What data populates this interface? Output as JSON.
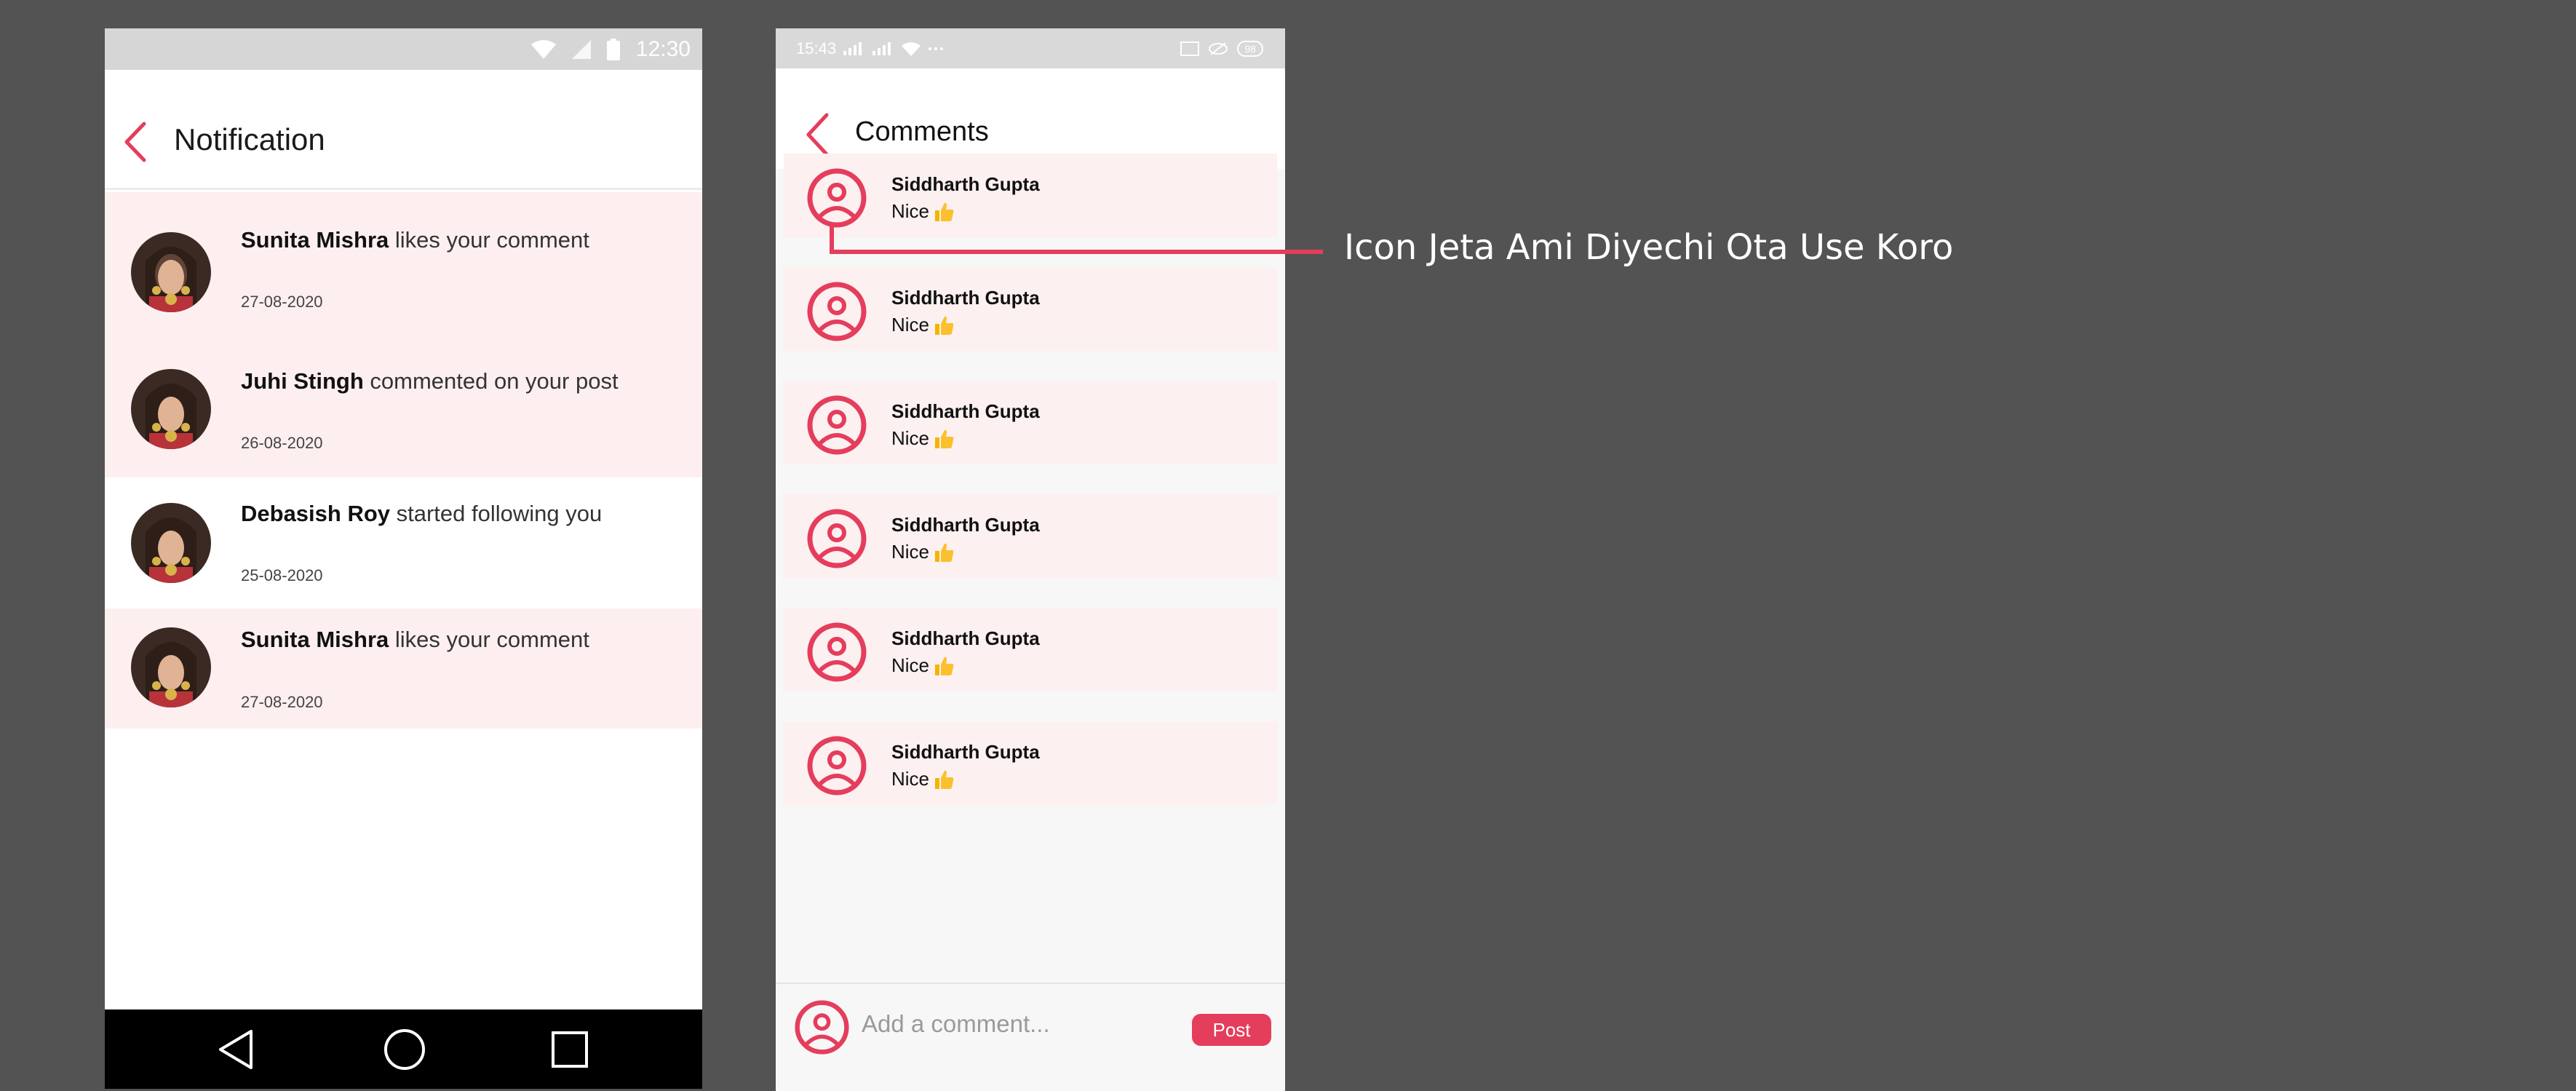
{
  "colors": {
    "accent": "#e53d5c",
    "background": "#535353",
    "highlight_row": "#fdeff0",
    "comment_row": "#fcf0f0"
  },
  "notification_screen": {
    "status_time": "12:30",
    "title": "Notification",
    "items": [
      {
        "name": "Sunita Mishra",
        "action": " likes your comment",
        "date": "27-08-2020",
        "highlight": true,
        "avatar": "bride-avatar"
      },
      {
        "name": "Juhi Stingh",
        "action": " commented on your post",
        "date": "26-08-2020",
        "highlight": true,
        "avatar": "bride-avatar"
      },
      {
        "name": "Debasish Roy",
        "action": " started following you",
        "date": "25-08-2020",
        "highlight": false,
        "avatar": "bride-avatar"
      },
      {
        "name": "Sunita Mishra",
        "action": " likes your comment",
        "date": "27-08-2020",
        "highlight": true,
        "avatar": "bride-avatar"
      }
    ],
    "nav_icons": [
      "back-triangle-icon",
      "home-circle-icon",
      "recents-square-icon"
    ]
  },
  "comments_screen": {
    "status_time": "15:43",
    "status_battery": "98",
    "title": "Comments",
    "comments": [
      {
        "name": "Siddharth Gupta",
        "text": "Nice",
        "emoji": "thumbs-up-icon"
      },
      {
        "name": "Siddharth Gupta",
        "text": "Nice",
        "emoji": "thumbs-up-icon"
      },
      {
        "name": "Siddharth Gupta",
        "text": "Nice",
        "emoji": "thumbs-up-icon"
      },
      {
        "name": "Siddharth Gupta",
        "text": "Nice",
        "emoji": "thumbs-up-icon"
      },
      {
        "name": "Siddharth Gupta",
        "text": "Nice",
        "emoji": "thumbs-up-icon"
      },
      {
        "name": "Siddharth Gupta",
        "text": "Nice",
        "emoji": "thumbs-up-icon"
      }
    ],
    "composer": {
      "placeholder": "Add a comment...",
      "post_label": "Post"
    }
  },
  "annotation": {
    "label": "Icon Jeta Ami Diyechi Ota Use Koro"
  }
}
